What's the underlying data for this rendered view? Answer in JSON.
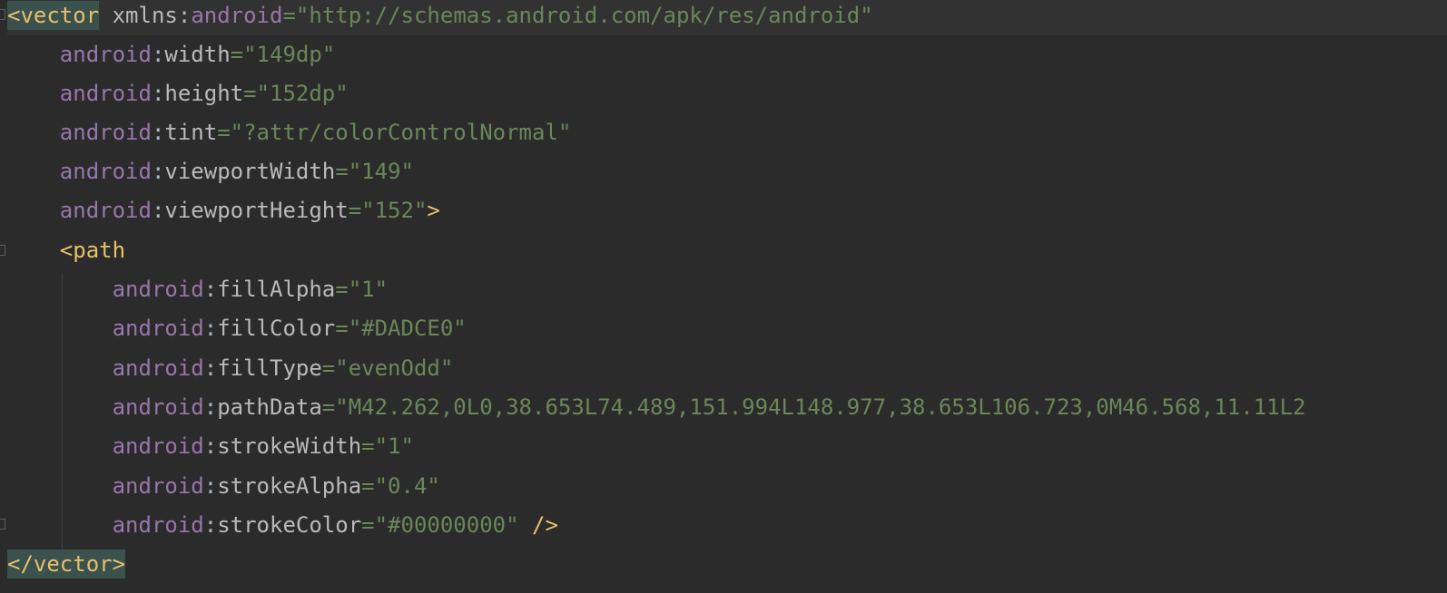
{
  "editor": {
    "lines": [
      {
        "open": "<",
        "tag": "vector",
        "prefix": "xmlns",
        "sep": ":",
        "attr": "android",
        "eq": "=",
        "value": "\"http://schemas.android.com/apk/res/android\""
      },
      {
        "ns": "android",
        "sep": ":",
        "attr": "width",
        "eq": "=",
        "value": "\"149dp\""
      },
      {
        "ns": "android",
        "sep": ":",
        "attr": "height",
        "eq": "=",
        "value": "\"152dp\""
      },
      {
        "ns": "android",
        "sep": ":",
        "attr": "tint",
        "eq": "=",
        "value": "\"?attr/colorControlNormal\""
      },
      {
        "ns": "android",
        "sep": ":",
        "attr": "viewportWidth",
        "eq": "=",
        "value": "\"149\""
      },
      {
        "ns": "android",
        "sep": ":",
        "attr": "viewportHeight",
        "eq": "=",
        "value": "\"152\"",
        "close": ">"
      },
      {
        "open": "<",
        "tag": "path"
      },
      {
        "ns": "android",
        "sep": ":",
        "attr": "fillAlpha",
        "eq": "=",
        "value": "\"1\""
      },
      {
        "ns": "android",
        "sep": ":",
        "attr": "fillColor",
        "eq": "=",
        "value": "\"#DADCE0\""
      },
      {
        "ns": "android",
        "sep": ":",
        "attr": "fillType",
        "eq": "=",
        "value": "\"evenOdd\""
      },
      {
        "ns": "android",
        "sep": ":",
        "attr": "pathData",
        "eq": "=",
        "value": "\"M42.262,0L0,38.653L74.489,151.994L148.977,38.653L106.723,0M46.568,11.11L2"
      },
      {
        "ns": "android",
        "sep": ":",
        "attr": "strokeWidth",
        "eq": "=",
        "value": "\"1\""
      },
      {
        "ns": "android",
        "sep": ":",
        "attr": "strokeAlpha",
        "eq": "=",
        "value": "\"0.4\""
      },
      {
        "ns": "android",
        "sep": ":",
        "attr": "strokeColor",
        "eq": "=",
        "value": "\"#00000000\"",
        "close": " />"
      },
      {
        "closing": "</vector>"
      }
    ]
  },
  "colors": {
    "background": "#2b2b2b",
    "tag": "#e8bf6a",
    "namespace": "#9876aa",
    "attribute": "#bababa",
    "string": "#6a8759",
    "tag_highlight": "#3b514d"
  }
}
